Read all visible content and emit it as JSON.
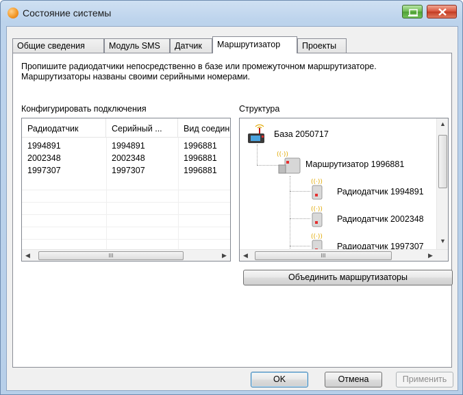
{
  "window": {
    "title": "Состояние системы"
  },
  "tabs": [
    {
      "label": "Общие сведения"
    },
    {
      "label": "Модуль SMS"
    },
    {
      "label": "Датчик"
    },
    {
      "label": "Маршрутизатор"
    },
    {
      "label": "Проекты"
    }
  ],
  "active_tab": "Маршрутизатор",
  "description": {
    "line1": "Пропишите радиодатчики непосредственно в базе или промежуточном маршрутизаторе.",
    "line2": "Маршрутизаторы названы своими серийными номерами."
  },
  "connections": {
    "label": "Конфигурировать подключения",
    "columns": [
      "Радиодатчик",
      "Серийный ...",
      "Вид соедин"
    ],
    "rows": [
      [
        "1994891",
        "1994891",
        "1996881"
      ],
      [
        "2002348",
        "2002348",
        "1996881"
      ],
      [
        "1997307",
        "1997307",
        "1996881"
      ]
    ]
  },
  "structure": {
    "label": "Структура",
    "base": "База 2050717",
    "router": "Маршрутизатор 1996881",
    "sensors": [
      "Радиодатчик 1994891",
      "Радиодатчик 2002348",
      "Радиодатчик 1997307"
    ]
  },
  "buttons": {
    "merge": "Объединить маршрутизаторы",
    "ok": "OK",
    "cancel": "Отмена",
    "apply": "Применить"
  },
  "scroll_glyphs": {
    "left": "◀",
    "right": "▶",
    "up": "▲",
    "down": "▼",
    "grip": "III"
  },
  "icons": {
    "app": "testo-app-icon",
    "minimize": "minimize-icon",
    "close": "close-icon",
    "base": "base-station-icon",
    "router": "router-icon",
    "sensor": "radio-sensor-icon"
  },
  "colors": {
    "accent": "#3c7fb1",
    "close": "#c13a22",
    "minimize": "#4ea035"
  }
}
